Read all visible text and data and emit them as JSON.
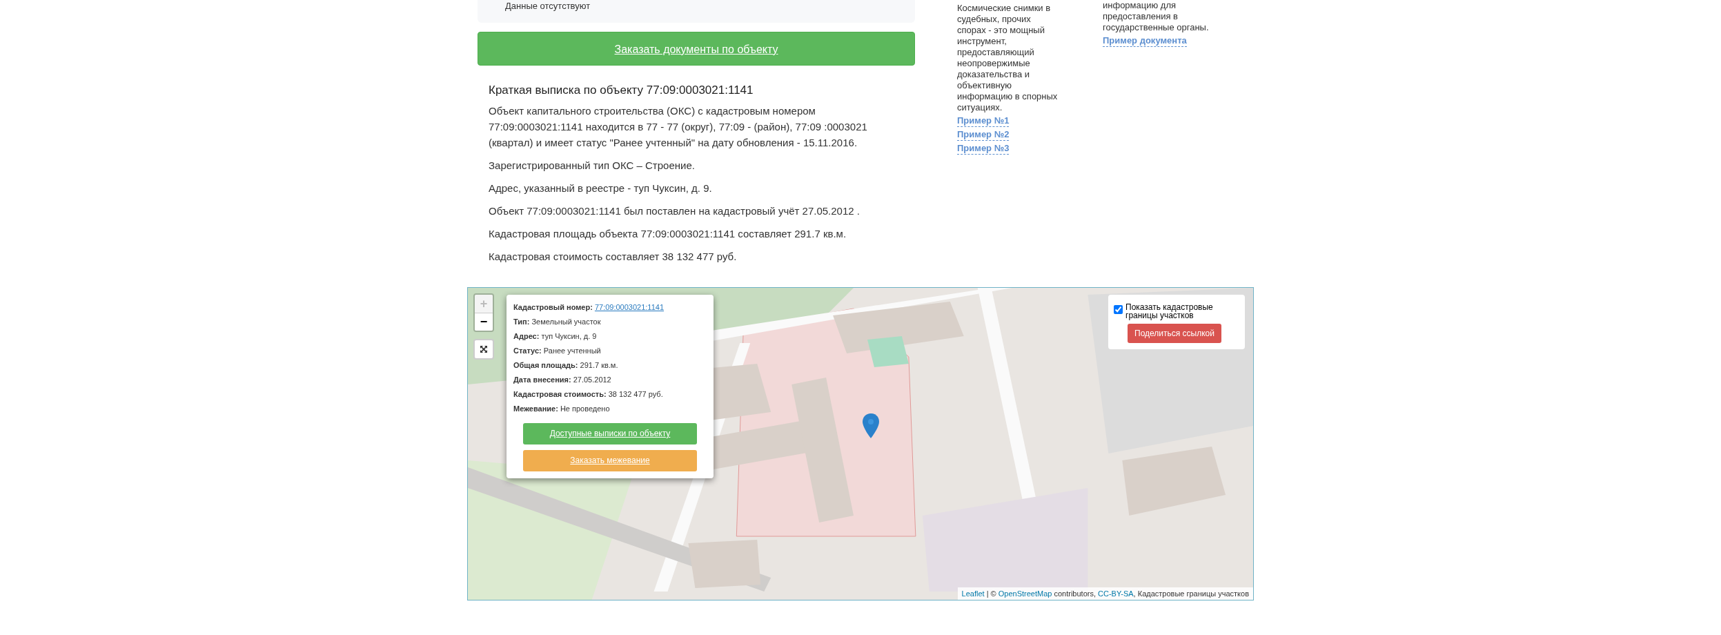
{
  "summary_card": {
    "text": "Данные отсутствуют"
  },
  "order_button": "Заказать документы по объекту",
  "extract": {
    "title": "Краткая выписка по объекту 77:09:0003021:1141",
    "paragraphs": [
      "Объект капитального строительства (ОКС) с кадастровым номером 77:09:0003021:1141 находится в 77 - 77 (округ), 77:09 - (район), 77:09 :0003021 (квартал) и имеет статус \"Ранее учтенный\" на дату обновления - 15.11.2016.",
      "Зарегистрированный тип ОКС – Строение.",
      "Адрес, указанный в реестре - туп Чуксин, д. 9.",
      "Объект 77:09:0003021:1141 был поставлен на кадастровый учёт 27.05.2012 .",
      "Кадастровая площадь объекта 77:09:0003021:1141 составляет 291.7 кв.м.",
      "Кадастровая стоимость составляет 38 132 477 руб."
    ]
  },
  "satellite_info": {
    "text": "Космические снимки в судебных, прочих спорах - это мощный инструмент, предоставляющий неопровержимые доказательства и объективную информацию в спорных ситуациях.",
    "links": [
      "Пример №1",
      "Пример №2",
      "Пример №3"
    ]
  },
  "document_info": {
    "text": "информацию для предоставления в государственные органы.",
    "links": [
      "Пример документа"
    ]
  },
  "map": {
    "zoom_in": "+",
    "zoom_out": "−",
    "popup": {
      "fields": [
        {
          "label": "Кадастровый номер:",
          "value": "77:09:0003021:1141",
          "kind": "link"
        },
        {
          "label": "Тип:",
          "value": "Земельный участок",
          "kind": "text"
        },
        {
          "label": "Адрес:",
          "value": "туп Чуксин, д. 9",
          "kind": "text"
        },
        {
          "label": "Статус:",
          "value": "Ранее учтенный",
          "kind": "text"
        },
        {
          "label": "Общая площадь:",
          "value": "291.7 кв.м.",
          "kind": "text"
        },
        {
          "label": "Дата внесения:",
          "value": "27.05.2012",
          "kind": "text"
        },
        {
          "label": "Кадастровая стоимость:",
          "value": "38 132 477 руб.",
          "kind": "text"
        },
        {
          "label": "Межевание:",
          "value": "Не проведено",
          "kind": "text"
        }
      ],
      "buttons": [
        {
          "label": "Доступные выписки по объекту",
          "kind": "success"
        },
        {
          "label": "Заказать межевание",
          "kind": "warning"
        }
      ]
    },
    "layers": {
      "checkbox_label": "Показать кадастровые границы участков",
      "checked": true,
      "share_button": "Поделиться ссылкой"
    },
    "attribution": [
      {
        "text": "Leaflet",
        "kind": "link"
      },
      {
        "text": " | © ",
        "kind": "text"
      },
      {
        "text": "OpenStreetMap",
        "kind": "link"
      },
      {
        "text": " contributors, ",
        "kind": "text"
      },
      {
        "text": "CC-BY-SA",
        "kind": "link"
      },
      {
        "text": ", Кадастровые границы участков",
        "kind": "text"
      }
    ]
  }
}
